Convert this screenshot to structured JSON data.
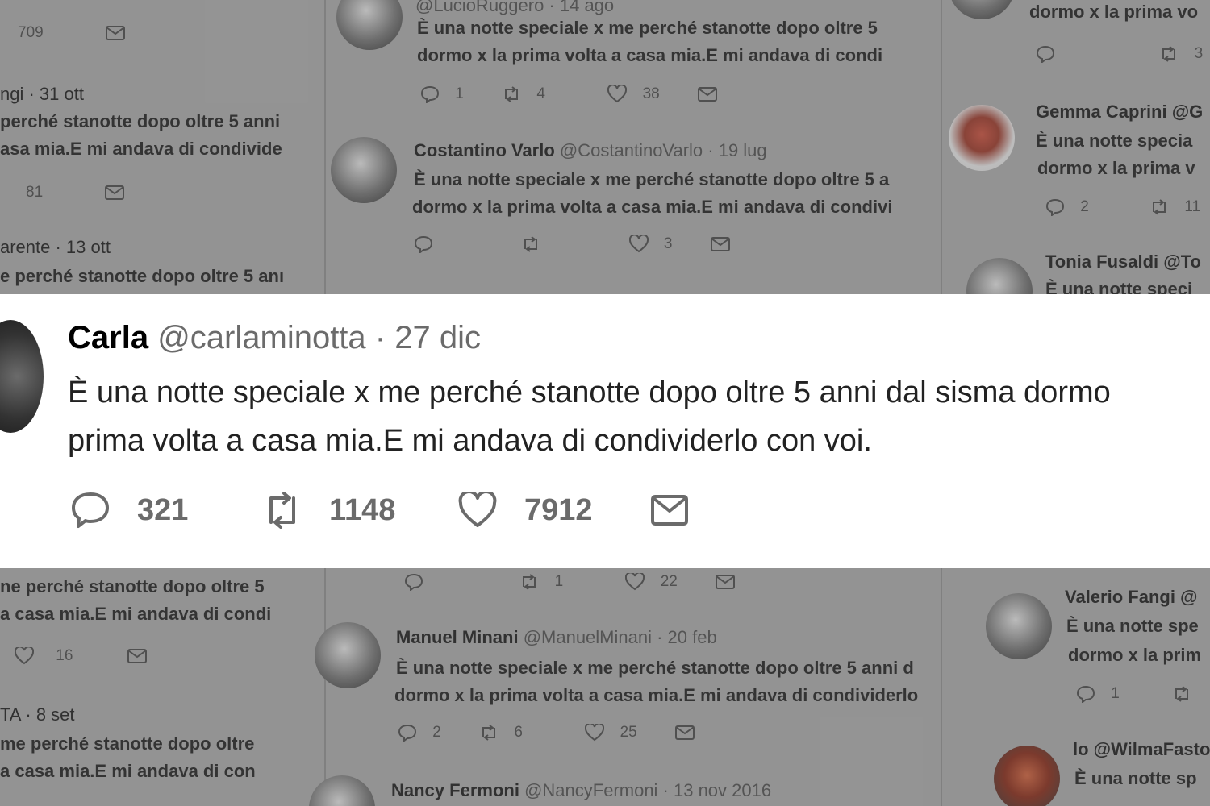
{
  "featured": {
    "name": "Carla",
    "handle": "@carlaminotta",
    "date": "· 27 dic",
    "text_line1": "È una notte speciale x me perché stanotte dopo oltre 5 anni dal sisma dormo",
    "text_line2": "prima volta a casa mia.E mi andava di condividerlo con voi.",
    "replies": "321",
    "retweets": "1148",
    "likes": "7912"
  },
  "bg_left": [
    {
      "hdr": "",
      "line1": "",
      "line2": "",
      "count_a": "709"
    },
    {
      "hdr": "ngi · 31 ott",
      "line1": "perché stanotte dopo oltre 5 anni",
      "line2": "asa mia.E mi andava di condivide",
      "count_a": "81"
    },
    {
      "hdr": "arente · 13 ott",
      "line1": "e perché stanotte dopo oltre 5 anı",
      "line2": "",
      "count_a": ""
    },
    {
      "hdr": "",
      "line1": "ne perché stanotte dopo oltre 5",
      "line2": "a casa mia.E mi andava di condi",
      "count_a": "16"
    },
    {
      "hdr": "TA · 8 set",
      "line1": "me perché stanotte dopo oltre",
      "line2": "a casa mia.E mi andava di con",
      "count_a": ""
    }
  ],
  "bg_mid": [
    {
      "name": "",
      "handle": "@LucioRuggero · 14 ago",
      "line1": "È una notte speciale x me perché stanotte dopo oltre 5",
      "line2": "dormo x la prima volta a casa mia.E mi andava di condi",
      "replies": "1",
      "retweets": "4",
      "likes": "38"
    },
    {
      "name": "Costantino Varlo",
      "handle": "@CostantinoVarlo · 19 lug",
      "line1": "È una notte speciale x me perché stanotte dopo oltre 5 a",
      "line2": "dormo x la prima volta a casa mia.E mi andava di condivi",
      "replies": "",
      "retweets": "",
      "likes": "3"
    },
    {
      "name": "",
      "handle": "",
      "line1": "",
      "line2": "",
      "replies": "",
      "retweets": "1",
      "likes": "22"
    },
    {
      "name": "Manuel Minani",
      "handle": "@ManuelMinani · 20 feb",
      "line1": "È una notte speciale x me perché stanotte dopo oltre 5 anni d",
      "line2": "dormo x la prima volta a casa mia.E mi andava di condividerlo",
      "replies": "2",
      "retweets": "6",
      "likes": "25"
    },
    {
      "name": "Nancy Fermoni",
      "handle": "@NancyFermoni · 13 nov 2016",
      "line1": "",
      "line2": "",
      "replies": "",
      "retweets": "",
      "likes": ""
    }
  ],
  "bg_right": [
    {
      "name": "",
      "line1": "dormo x la prima vo",
      "line2": "",
      "replies": "",
      "retweets": "3"
    },
    {
      "name": "Gemma Caprini @G",
      "line1": "È una notte specia",
      "line2": "dormo x la prima v",
      "replies": "2",
      "retweets": "11"
    },
    {
      "name": "Tonia Fusaldi @To",
      "line1": "È una notte speci",
      "line2": "",
      "replies": "",
      "retweets": ""
    },
    {
      "name": "Valerio Fangi @",
      "line1": "È una notte spe",
      "line2": "dormo x la prim",
      "replies": "1",
      "retweets": ""
    },
    {
      "name": "lo @WilmaFasto",
      "line1": "È una notte sp",
      "line2": "",
      "replies": "",
      "retweets": ""
    }
  ],
  "colors": {
    "accent_text": "#6b6b6b",
    "card_bg": "#ffffff",
    "background": "#a7a7a7"
  }
}
